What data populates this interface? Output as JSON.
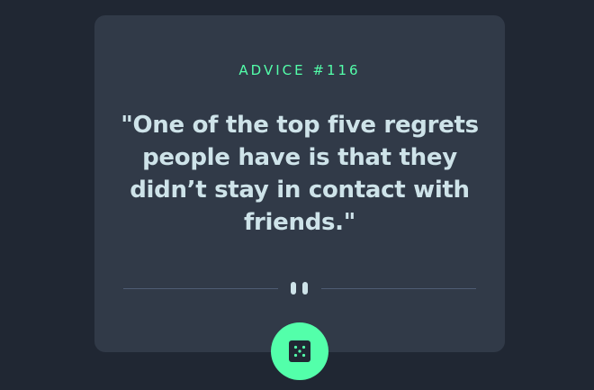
{
  "card": {
    "advice_id": "ADVICE #116",
    "quote": "\"One of the top five regrets people have is that they didn’t stay in contact with friends.\""
  },
  "divider": {
    "icon": "pause-icon"
  },
  "dice_button": {
    "icon": "dice-icon"
  },
  "colors": {
    "background": "#202733",
    "card": "#313a48",
    "accent": "#53ffaa",
    "text": "#cee3e9",
    "divider": "#4f5d74"
  }
}
